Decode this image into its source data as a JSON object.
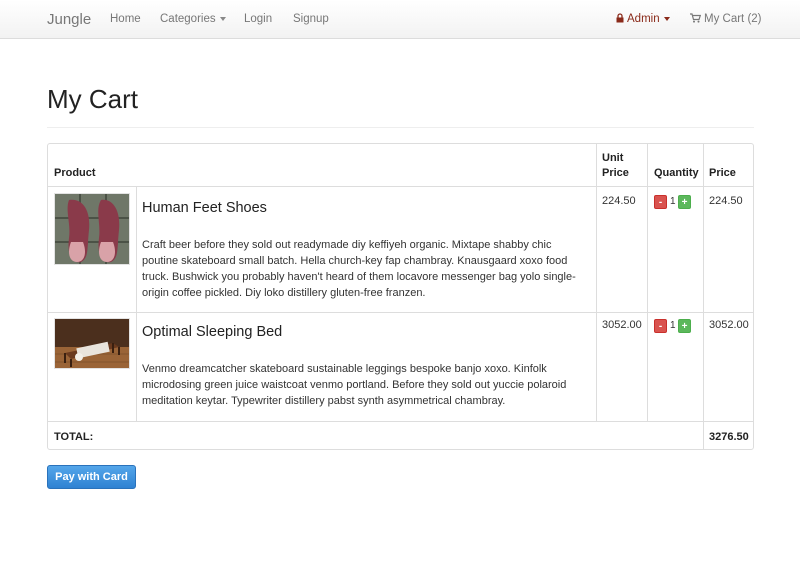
{
  "navbar": {
    "brand": "Jungle",
    "links": {
      "home": "Home",
      "categories": "Categories",
      "login": "Login",
      "signup": "Signup"
    },
    "admin": "Admin",
    "cart": "My Cart (2)"
  },
  "page": {
    "title": "My Cart"
  },
  "table": {
    "headers": {
      "product": "Product",
      "unit_price_line1": "Unit",
      "unit_price_line2": "Price",
      "quantity": "Quantity",
      "price": "Price"
    },
    "items": [
      {
        "name": "Human Feet Shoes",
        "description": "Craft beer before they sold out readymade diy keffiyeh organic. Mixtape shabby chic poutine skateboard small batch. Hella church-key fap chambray. Knausgaard xoxo food truck. Bushwick you probably haven't heard of them locavore messenger bag yolo single-origin coffee pickled. Diy loko distillery gluten-free franzen.",
        "unit_price": "224.50",
        "quantity": "1",
        "price": "224.50",
        "minus": "-",
        "plus": "+"
      },
      {
        "name": "Optimal Sleeping Bed",
        "description": "Venmo dreamcatcher skateboard sustainable leggings bespoke banjo xoxo. Kinfolk microdosing green juice waistcoat venmo portland. Before they sold out yuccie polaroid meditation keytar. Typewriter distillery pabst synth asymmetrical chambray.",
        "unit_price": "3052.00",
        "quantity": "1",
        "price": "3052.00",
        "minus": "-",
        "plus": "+"
      }
    ],
    "total_label": "TOTAL:",
    "total_value": "3276.50"
  },
  "pay_button": "Pay with Card",
  "colors": {
    "admin": "#8a2a1a",
    "pay_button": "#3a8ee0",
    "minus": "#d9534f",
    "plus": "#5cb85c"
  },
  "icons": {
    "admin": "lock-icon",
    "cart": "shopping-cart-icon"
  }
}
